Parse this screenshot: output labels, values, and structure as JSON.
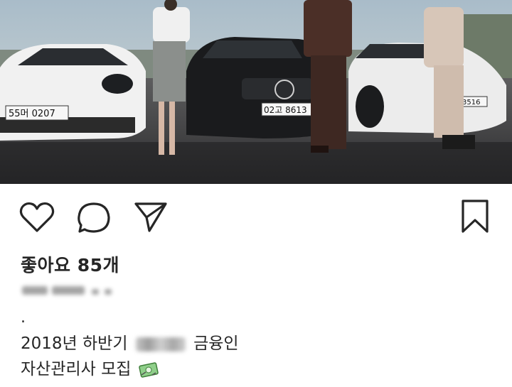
{
  "post": {
    "image": {
      "plates": [
        "55머 0207",
        "02고 8613",
        "3516"
      ]
    },
    "actions": {
      "like_icon": "heart-icon",
      "comment_icon": "comment-icon",
      "share_icon": "send-icon",
      "save_icon": "bookmark-icon"
    },
    "likes_text": "좋아요 85개",
    "caption": {
      "dot": ".",
      "line1_before": "2018년 하반기",
      "line1_after": "금융인",
      "line2": "자산관리사 모집"
    },
    "colors": {
      "text": "#262626",
      "background": "#ffffff"
    }
  }
}
